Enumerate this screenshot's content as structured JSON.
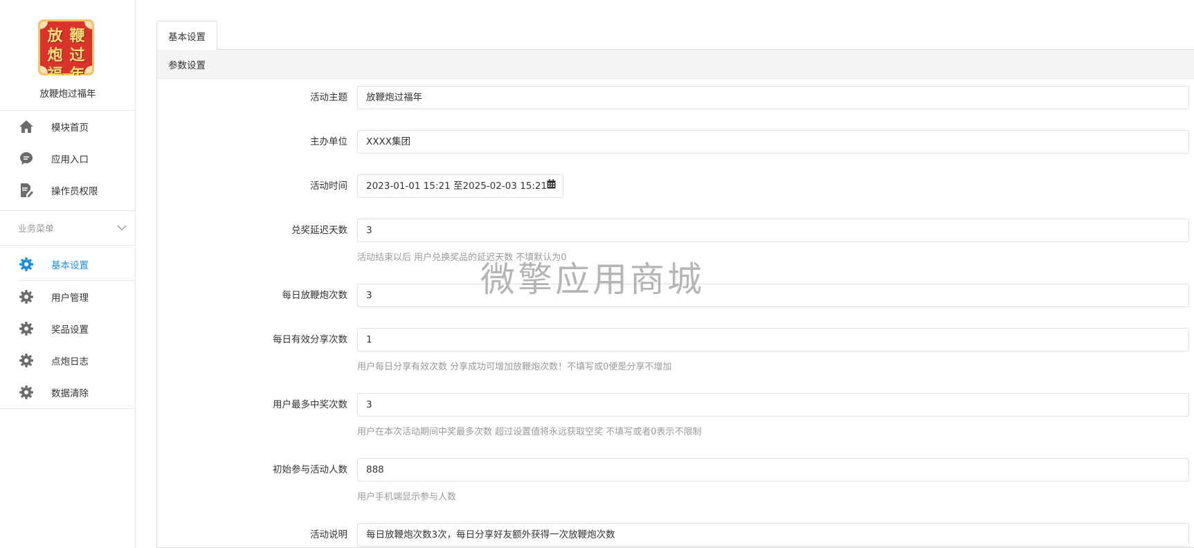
{
  "sidebar": {
    "logo_text": [
      "放",
      "鞭",
      "炮",
      "过",
      "福",
      "年"
    ],
    "module_name": "放鞭炮过福年",
    "top_items": [
      {
        "label": "模块首页",
        "icon": "home-icon"
      },
      {
        "label": "应用入口",
        "icon": "chat-icon"
      },
      {
        "label": "操作员权限",
        "icon": "document-edit-icon"
      }
    ],
    "group_title": "业务菜单",
    "group_items": [
      {
        "label": "基本设置",
        "icon": "gear-icon",
        "active": true
      },
      {
        "label": "用户管理",
        "icon": "gear-icon"
      },
      {
        "label": "奖品设置",
        "icon": "gear-icon"
      },
      {
        "label": "点炮日志",
        "icon": "gear-icon"
      },
      {
        "label": "数据清除",
        "icon": "gear-icon"
      }
    ]
  },
  "tabs": [
    {
      "label": "基本设置"
    }
  ],
  "panel": {
    "title": "参数设置",
    "fields": [
      {
        "label": "活动主题",
        "value": "放鞭炮过福年",
        "help": ""
      },
      {
        "label": "主办单位",
        "value": "XXXX集团",
        "help": ""
      },
      {
        "label": "活动时间",
        "value": "2023-01-01 15:21 至2025-02-03 15:21",
        "help": ""
      },
      {
        "label": "兑奖延迟天数",
        "value": "3",
        "help": "活动结束以后 用户兑换奖品的延迟天数 不填默认为0"
      },
      {
        "label": "每日放鞭炮次数",
        "value": "3",
        "help": ""
      },
      {
        "label": "每日有效分享次数",
        "value": "1",
        "help": "用户每日分享有效次数 分享成功可增加放鞭炮次数！不填写或0便是分享不增加"
      },
      {
        "label": "用户最多中奖次数",
        "value": "3",
        "help": "用户在本次活动期间中奖最多次数 超过设置值将永远获取空奖 不填写或者0表示不限制"
      },
      {
        "label": "初始参与活动人数",
        "value": "888",
        "help": "用户手机端显示参与人数"
      },
      {
        "label": "活动说明",
        "value": "每日放鞭炮次数3次，每日分享好友额外获得一次放鞭炮次数",
        "help": ""
      }
    ]
  },
  "watermark": "微擎应用商城",
  "colors": {
    "accent": "#1b8fe6",
    "icon": "#6b6b6b",
    "help_text": "#999999",
    "logo_red": "#d9332b",
    "logo_gold": "#fde27a"
  }
}
